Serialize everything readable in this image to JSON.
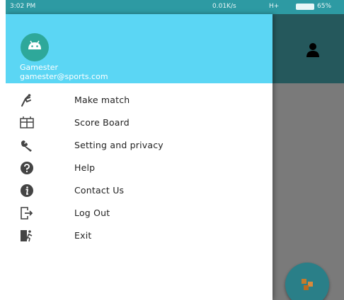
{
  "status_bar": {
    "time": "3:02 PM",
    "speed": "0.01K/s",
    "network": "H+",
    "battery_percent": "65%"
  },
  "drawer": {
    "header_color": "#5bd6f4",
    "user": {
      "name": "Gamester",
      "email": "gamester@sports.com",
      "avatar_icon": "android-icon"
    },
    "items": [
      {
        "label": "Make match",
        "icon": "player-icon"
      },
      {
        "label": "Score Board",
        "icon": "scoreboard-icon"
      },
      {
        "label": "Setting and privacy",
        "icon": "wrench-icon"
      },
      {
        "label": "Help",
        "icon": "help-icon"
      },
      {
        "label": "Contact Us",
        "icon": "info-icon"
      },
      {
        "label": "Log Out",
        "icon": "logout-icon"
      },
      {
        "label": "Exit",
        "icon": "exit-icon"
      }
    ]
  },
  "background_app": {
    "toolbar_color": "#25585c",
    "toolbar_icon": "person-icon",
    "fab_icon": "game-icon"
  }
}
